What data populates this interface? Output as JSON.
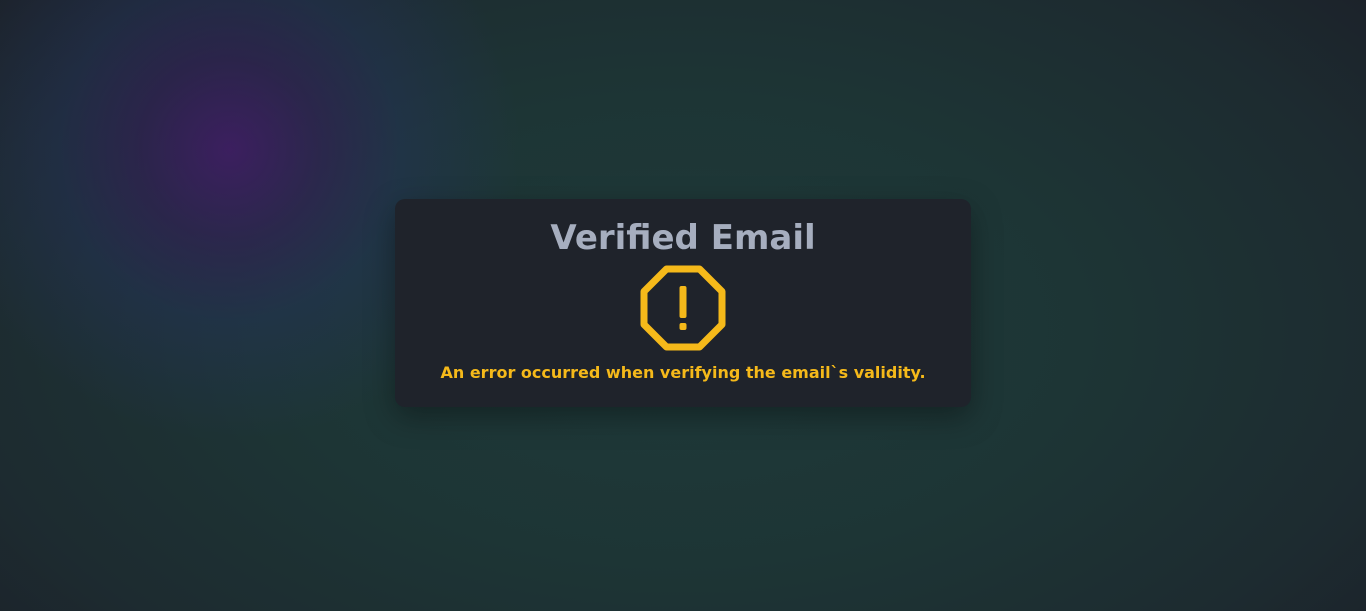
{
  "card": {
    "title": "Verified Email",
    "icon": "warning-octagon-icon",
    "message": "An error occurred when verifying the email`s validity."
  },
  "colors": {
    "title": "#a6aebf",
    "warning": "#f5b91a",
    "card_background": "#1f232b"
  }
}
